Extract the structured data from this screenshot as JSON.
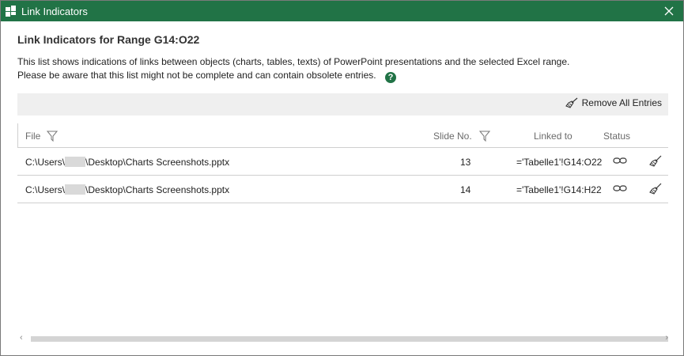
{
  "window": {
    "title": "Link Indicators",
    "accent_color": "#217346"
  },
  "heading": "Link Indicators for Range G14:O22",
  "description": {
    "line1": "This list shows indications of links between objects (charts, tables, texts) of PowerPoint presentations and the selected Excel range.",
    "line2": "Please be aware that this list might not be complete and can contain obsolete entries."
  },
  "toolbar": {
    "remove_all_label": "Remove All Entries"
  },
  "table": {
    "columns": {
      "file": "File",
      "slide": "Slide No.",
      "linked_to": "Linked to",
      "status": "Status"
    },
    "rows": [
      {
        "file_prefix": "C:\\Users\\",
        "file_suffix": "\\Desktop\\Charts Screenshots.pptx",
        "slide": "13",
        "linked_to": "='Tabelle1'!G14:O22"
      },
      {
        "file_prefix": "C:\\Users\\",
        "file_suffix": "\\Desktop\\Charts Screenshots.pptx",
        "slide": "14",
        "linked_to": "='Tabelle1'!G14:H22"
      }
    ]
  }
}
